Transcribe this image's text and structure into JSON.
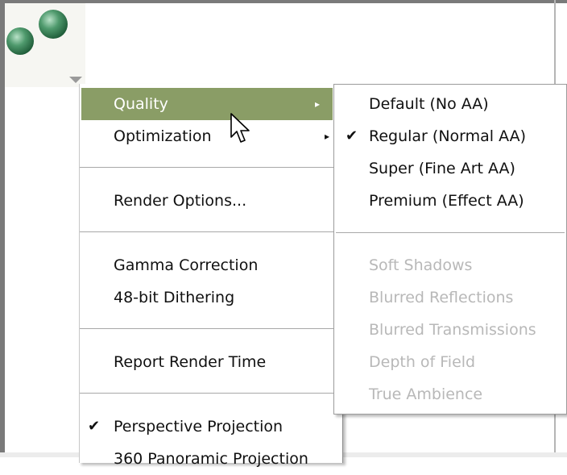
{
  "toolbar": {
    "dropdown_icon": "triangle-down",
    "logo_icon": "green-spheres"
  },
  "menu": {
    "items": [
      {
        "label": "Quality",
        "submenu_arrow": "▸",
        "selected": true
      },
      {
        "label": "Optimization",
        "submenu_arrow": "▸"
      },
      {
        "label": "Render Options..."
      },
      {
        "label": "Gamma Correction"
      },
      {
        "label": "48-bit Dithering"
      },
      {
        "label": "Report Render Time"
      },
      {
        "label": "Perspective Projection",
        "checked": true,
        "check": "✔"
      },
      {
        "label": "360 Panoramic Projection"
      }
    ]
  },
  "submenu": {
    "items": [
      {
        "label": "Default (No AA)"
      },
      {
        "label": "Regular (Normal AA)",
        "checked": true,
        "check": "✔"
      },
      {
        "label": "Super (Fine Art AA)"
      },
      {
        "label": "Premium (Effect AA)"
      },
      {
        "label": "Soft Shadows",
        "disabled": true
      },
      {
        "label": "Blurred Reflections",
        "disabled": true
      },
      {
        "label": "Blurred Transmissions",
        "disabled": true
      },
      {
        "label": "Depth of Field",
        "disabled": true
      },
      {
        "label": "True Ambience",
        "disabled": true
      }
    ]
  },
  "colors": {
    "highlight": "#8a9d66",
    "disabled_text": "#b8b8b8"
  }
}
